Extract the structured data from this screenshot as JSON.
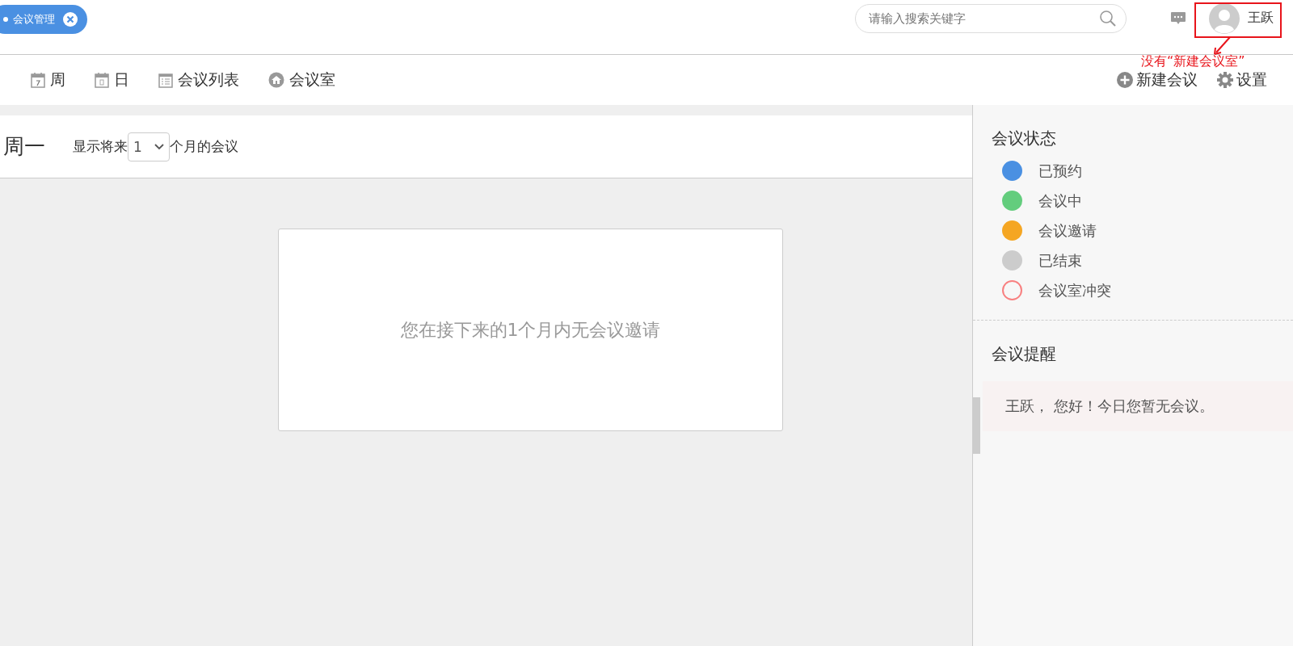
{
  "top_bar": {
    "tab": {
      "label": "会议管理"
    },
    "search": {
      "placeholder": "请输入搜索关键字"
    },
    "user": {
      "name": "王跃"
    }
  },
  "annotation": {
    "text": "没有“新建会议室”"
  },
  "nav": {
    "views": [
      {
        "label": "周",
        "kind": "week"
      },
      {
        "label": "日",
        "kind": "day"
      },
      {
        "label": "会议列表",
        "kind": "list"
      },
      {
        "label": "会议室",
        "kind": "room"
      }
    ],
    "actions": [
      {
        "label": "新建会议",
        "kind": "add"
      },
      {
        "label": "设置",
        "kind": "settings"
      }
    ]
  },
  "main": {
    "day": "周一",
    "filter_before": "显示将来",
    "months": "1",
    "filter_after": "个月的会议",
    "empty_message": "您在接下来的1个月内无会议邀请"
  },
  "sidebar": {
    "status_title": "会议状态",
    "statuses": [
      {
        "label": "已预约",
        "color": "#4a90e2",
        "kind": "filled"
      },
      {
        "label": "会议中",
        "color": "#63cd7d",
        "kind": "filled"
      },
      {
        "label": "会议邀请",
        "color": "#f5a623",
        "kind": "filled"
      },
      {
        "label": "已结束",
        "color": "#cccccc",
        "kind": "filled"
      },
      {
        "label": "会议室冲突",
        "color": "#f88080",
        "kind": "outline"
      }
    ],
    "reminder_title": "会议提醒",
    "reminder": "王跃， 您好！今日您暂无会议。"
  }
}
